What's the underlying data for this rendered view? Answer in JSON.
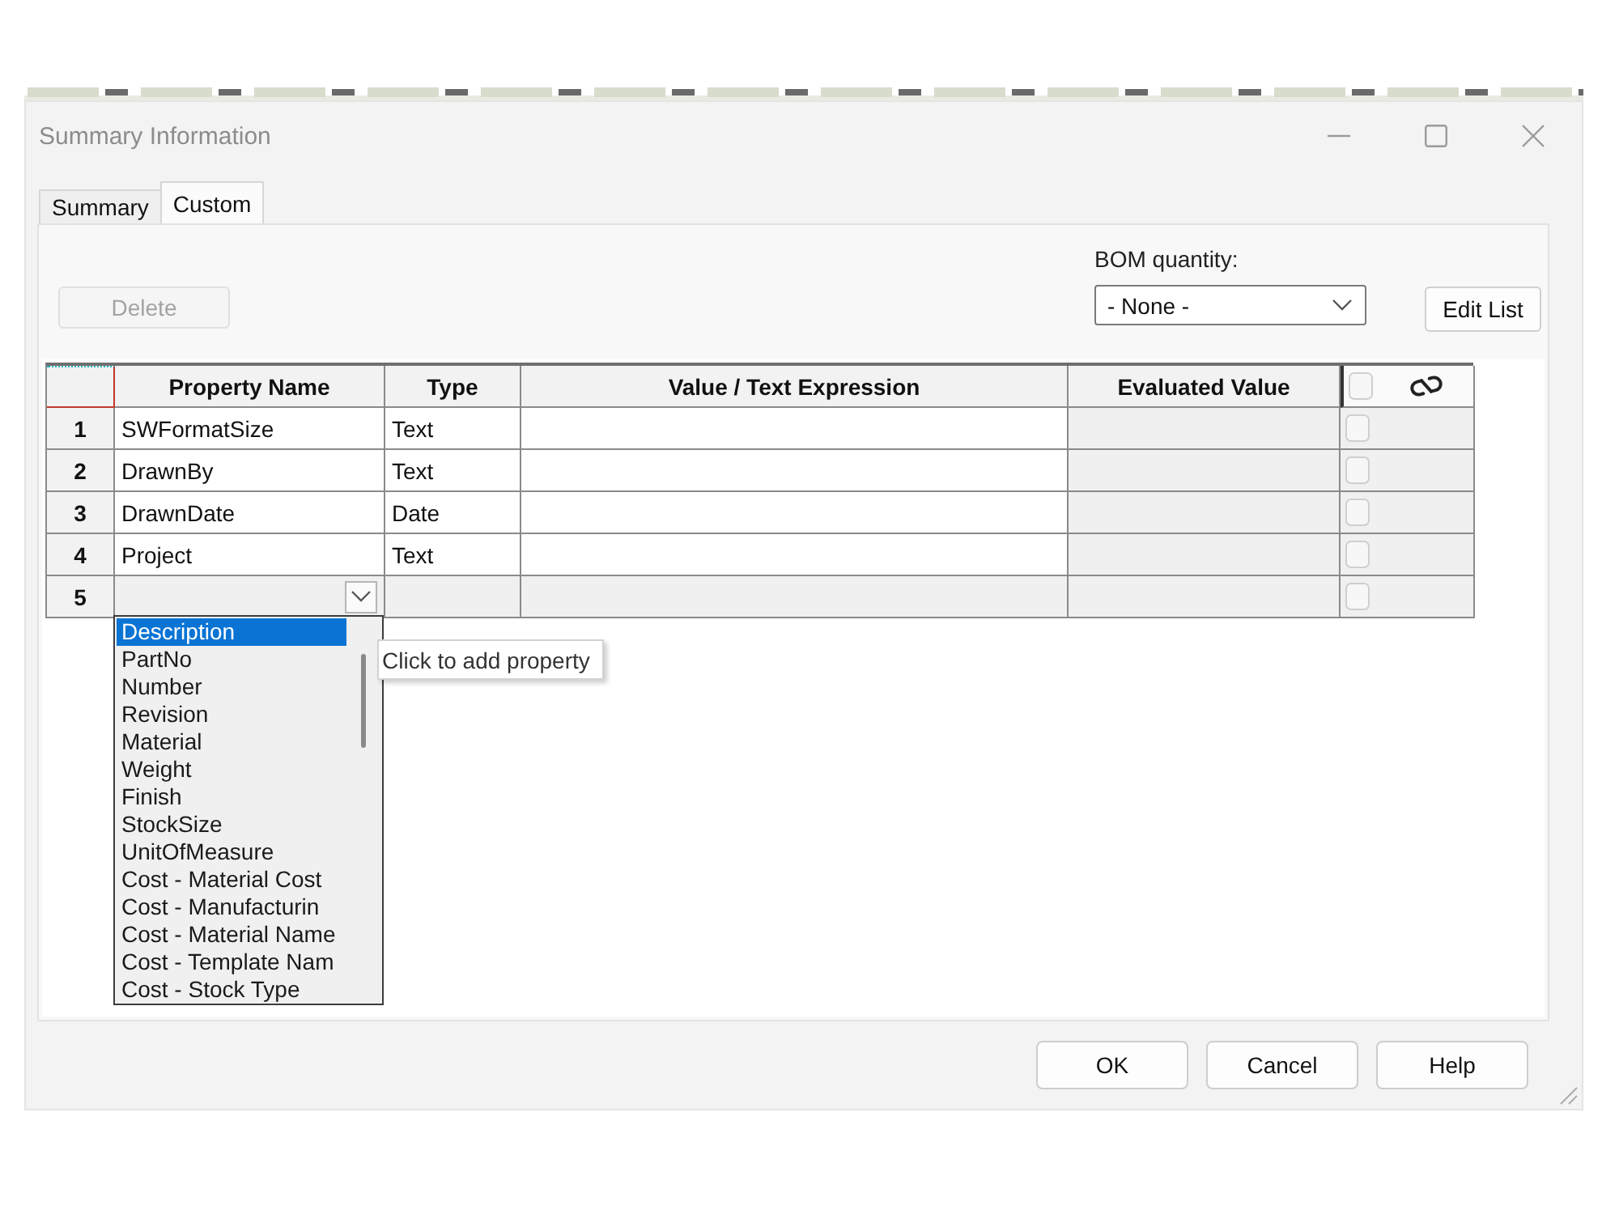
{
  "window": {
    "title": "Summary Information"
  },
  "tabs": [
    {
      "label": "Summary",
      "selected": false
    },
    {
      "label": "Custom",
      "selected": true
    }
  ],
  "delete_button": {
    "label": "Delete",
    "disabled": true
  },
  "bom_quantity": {
    "label": "BOM quantity:",
    "value": "- None -"
  },
  "edit_list_button": {
    "label": "Edit List"
  },
  "table": {
    "columns": [
      "Property Name",
      "Type",
      "Value / Text Expression",
      "Evaluated Value"
    ],
    "link_header_checked": false,
    "rows": [
      {
        "number": "1",
        "property_name": "SWFormatSize",
        "type": "Text",
        "editing": false,
        "checked": false
      },
      {
        "number": "2",
        "property_name": "DrawnBy",
        "type": "Text",
        "editing": false,
        "checked": false
      },
      {
        "number": "3",
        "property_name": "DrawnDate",
        "type": "Date",
        "editing": false,
        "checked": false
      },
      {
        "number": "4",
        "property_name": "Project",
        "type": "Text",
        "editing": false,
        "checked": false
      },
      {
        "number": "5",
        "editing": true,
        "checked": false
      }
    ]
  },
  "property_dropdown": {
    "items": [
      {
        "label": "Description",
        "selected": true
      },
      {
        "label": "PartNo",
        "selected": false
      },
      {
        "label": "Number",
        "selected": false
      },
      {
        "label": "Revision",
        "selected": false
      },
      {
        "label": "Material",
        "selected": false
      },
      {
        "label": "Weight",
        "selected": false
      },
      {
        "label": "Finish",
        "selected": false
      },
      {
        "label": "StockSize",
        "selected": false
      },
      {
        "label": "UnitOfMeasure",
        "selected": false
      },
      {
        "label": "Cost - Material Cost",
        "selected": false
      },
      {
        "label": "Cost - Manufacturin",
        "selected": false
      },
      {
        "label": "Cost - Material Name",
        "selected": false
      },
      {
        "label": "Cost - Template Nam",
        "selected": false
      },
      {
        "label": "Cost - Stock Type",
        "selected": false
      }
    ]
  },
  "tooltip": "Click to add property",
  "buttons": [
    "OK",
    "Cancel",
    "Help"
  ]
}
